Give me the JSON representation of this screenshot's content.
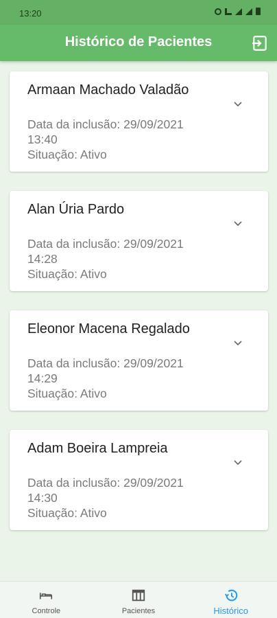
{
  "status_bar": {
    "time": "13:20"
  },
  "app_bar": {
    "title": "Histórico de Pacientes",
    "logout_icon": "logout-icon"
  },
  "patients": [
    {
      "name": "Armaan Machado Valadão",
      "inclusion_line": "Data da inclusão: 29/09/2021",
      "time": "13:40",
      "status": "Situação: Ativo"
    },
    {
      "name": "Alan Úria Pardo",
      "inclusion_line": "Data da inclusão: 29/09/2021",
      "time": "14:28",
      "status": "Situação: Ativo"
    },
    {
      "name": "Eleonor Macena Regalado",
      "inclusion_line": "Data da inclusão: 29/09/2021",
      "time": "14:29",
      "status": "Situação: Ativo"
    },
    {
      "name": "Adam Boeira Lampreia",
      "inclusion_line": "Data da inclusão: 29/09/2021",
      "time": "14:30",
      "status": "Situação: Ativo"
    }
  ],
  "bottom_nav": {
    "items": [
      {
        "label": "Controle",
        "icon": "bed-icon"
      },
      {
        "label": "Pacientes",
        "icon": "table-icon"
      },
      {
        "label": "Histórico",
        "icon": "history-icon",
        "active": true
      }
    ]
  },
  "colors": {
    "primary": "#66bb6a",
    "background": "#eaf4e8",
    "active_nav": "#2196f3"
  }
}
